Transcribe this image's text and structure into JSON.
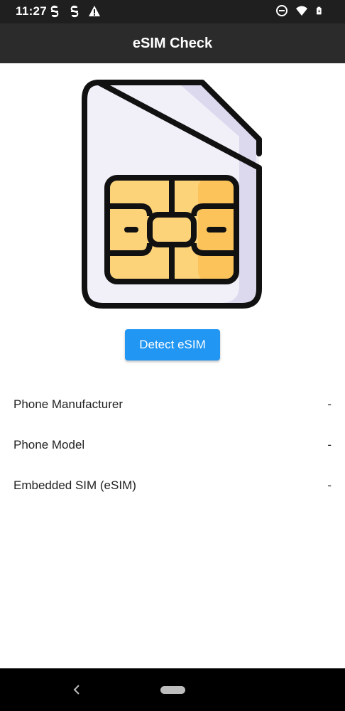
{
  "status_bar": {
    "time": "11:27",
    "left_icons": [
      "sync-s-icon",
      "sync-s-icon",
      "warning-icon"
    ],
    "right_icons": [
      "do-not-disturb-icon",
      "wifi-icon",
      "battery-icon"
    ]
  },
  "app_bar": {
    "title": "eSIM Check",
    "background": "#2b2b2b"
  },
  "illustration": {
    "icon": "sim-card-icon",
    "chip_color": "#fdd37a"
  },
  "detect_button": {
    "label": "Detect eSIM",
    "color": "#2196f3"
  },
  "info": [
    {
      "label": "Phone Manufacturer",
      "value": "-"
    },
    {
      "label": "Phone Model",
      "value": "-"
    },
    {
      "label": "Embedded SIM (eSIM)",
      "value": "-"
    }
  ],
  "nav_bar": {
    "icons": [
      "back-icon",
      "home-pill-icon"
    ]
  }
}
